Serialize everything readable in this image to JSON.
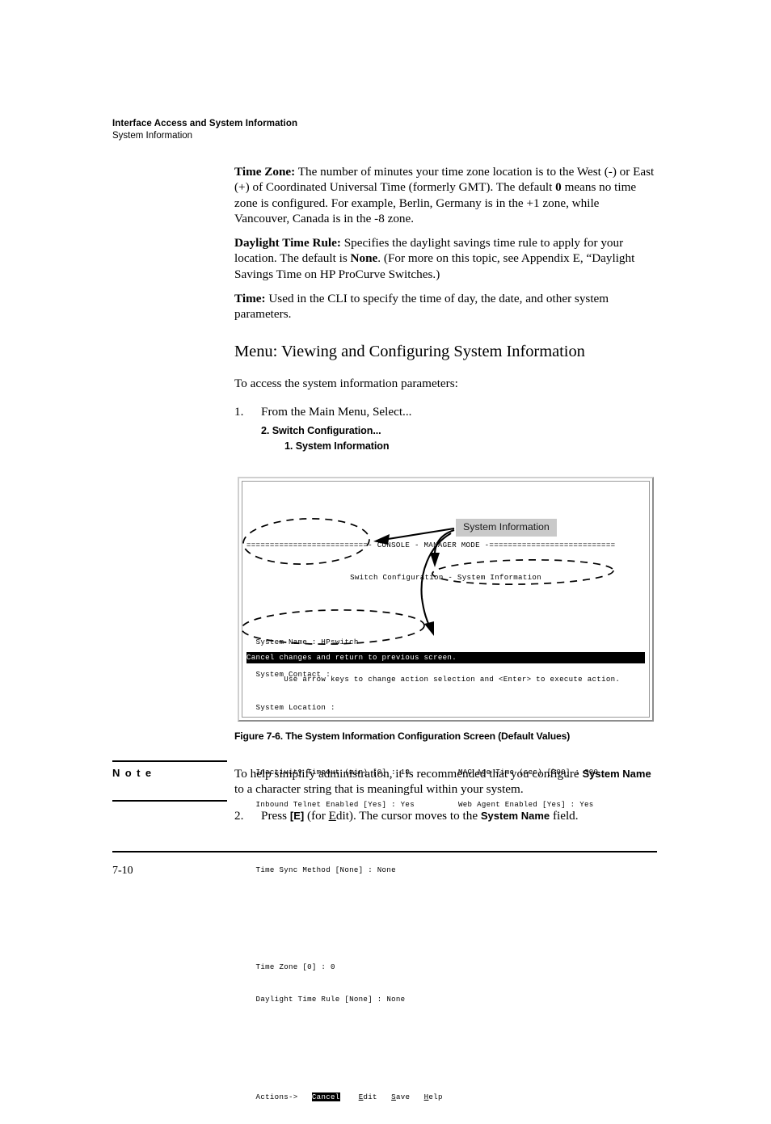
{
  "header": {
    "chapter": "Interface Access and System Information",
    "section": "System Information"
  },
  "paragraphs": {
    "time_zone_label": "Time Zone:",
    "time_zone_text": " The number of minutes your time zone location is to the West (-) or East (+) of Coordinated Universal Time (formerly GMT). The default ",
    "time_zone_default": "0",
    "time_zone_text2": " means no time zone is configured. For example, Berlin, Germany is in the +1 zone, while Vancouver, Canada is in the -8 zone.",
    "daylight_label": "Daylight Time Rule:",
    "daylight_text": " Specifies the daylight savings time rule to apply for your location. The default is ",
    "daylight_default": "None",
    "daylight_text2": ". (For more on this topic, see Appendix E, “Daylight Savings Time on HP ProCurve Switches.)",
    "time_label": "Time:",
    "time_text": " Used in the CLI to specify the time of day, the date, and other system parameters."
  },
  "section_heading": "Menu: Viewing and Configuring System Information",
  "intro": "To access the system information parameters:",
  "steps": {
    "step1_num": "1.",
    "step1_text": "From the Main Menu, Select...",
    "menu_level1": "2. Switch Configuration...",
    "menu_level2": "1. System Information",
    "step2_num": "2.",
    "step2_pre": "Press ",
    "step2_key": "[E]",
    "step2_mid": " (for ",
    "step2_underline": "E",
    "step2_mid2": "dit). The cursor moves to the ",
    "step2_field": "System Name",
    "step2_post": " field."
  },
  "terminal": {
    "title_bar": "==========================- CONSOLE - MANAGER MODE -===========================",
    "subtitle": "Switch Configuration - System Information",
    "system_name": "  System Name : HPswitch",
    "system_contact": "  System Contact :",
    "system_location": "  System Location :",
    "inactivity_timeout": "  Inactivity Timeout (min) [0] : 10",
    "mac_age_time": "MAC Age Time (sec) [300] : 300",
    "inbound_telnet": "  Inbound Telnet Enabled [Yes] : Yes",
    "web_agent": "Web Agent Enabled [Yes] : Yes",
    "time_sync": "  Time Sync Method [None] : None",
    "time_zone": "  Time Zone [0] : 0",
    "daylight_rule": "  Daylight Time Rule [None] : None",
    "actions_label": "  Actions->",
    "action_cancel": "Cancel",
    "action_edit_key": "E",
    "action_edit_rest": "dit",
    "action_save_key": "S",
    "action_save_rest": "ave",
    "action_help_key": "H",
    "action_help_rest": "elp",
    "status_highlight": "Cancel changes and return to previous screen.",
    "status_hint": "Use arrow keys to change action selection and <Enter> to execute action."
  },
  "callout": {
    "label": "System Information"
  },
  "figure_caption": "Figure 7-6.  The System Information Configuration Screen (Default Values)",
  "note": {
    "label": "N o t e",
    "text_pre": "To help simplify administration, it is recommended that you configure ",
    "bold_term": "System Name",
    "text_post": "  to a character string that is meaningful within your system."
  },
  "footer": {
    "page_number": "7-10"
  },
  "colors": {
    "callout_bg": "#c9c9c9",
    "terminal_frame": "#9a9a9a",
    "text": "#000000"
  }
}
